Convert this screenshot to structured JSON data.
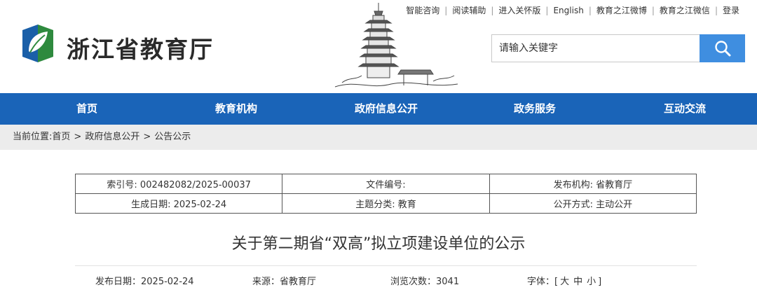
{
  "header": {
    "site_title": "浙江省教育厅",
    "top_links": [
      "智能咨询",
      "阅读辅助",
      "进入关怀版",
      "English",
      "教育之江微博",
      "教育之江微信",
      "登录"
    ],
    "search_placeholder": "请输入关键字"
  },
  "nav": {
    "items": [
      "首页",
      "教育机构",
      "政府信息公开",
      "政务服务",
      "互动交流"
    ]
  },
  "breadcrumb": {
    "prefix": "当前位置:",
    "items": [
      "首页",
      "政府信息公开",
      "公告公示"
    ],
    "separator": ">"
  },
  "meta": {
    "index_no": "索引号: 002482082/2025-00037",
    "doc_no": "文件编号:",
    "publisher": "发布机构: 省教育厅",
    "created": "生成日期: 2025-02-24",
    "category": "主题分类: 教育",
    "disclosure": "公开方式: 主动公开"
  },
  "article": {
    "title": "关于第二期省“双高”拟立项建设单位的公示",
    "publish_date": "发布日期：2025-02-24",
    "source": "来源：省教育厅",
    "views": "浏览次数：3041",
    "font_label": "字体：[",
    "font_sizes": [
      "大",
      "中",
      "小"
    ],
    "font_close": "]"
  },
  "colors": {
    "nav_bg": "#1a64b8",
    "search_button": "#3f8ee0",
    "breadcrumb_bg": "#ececec"
  }
}
